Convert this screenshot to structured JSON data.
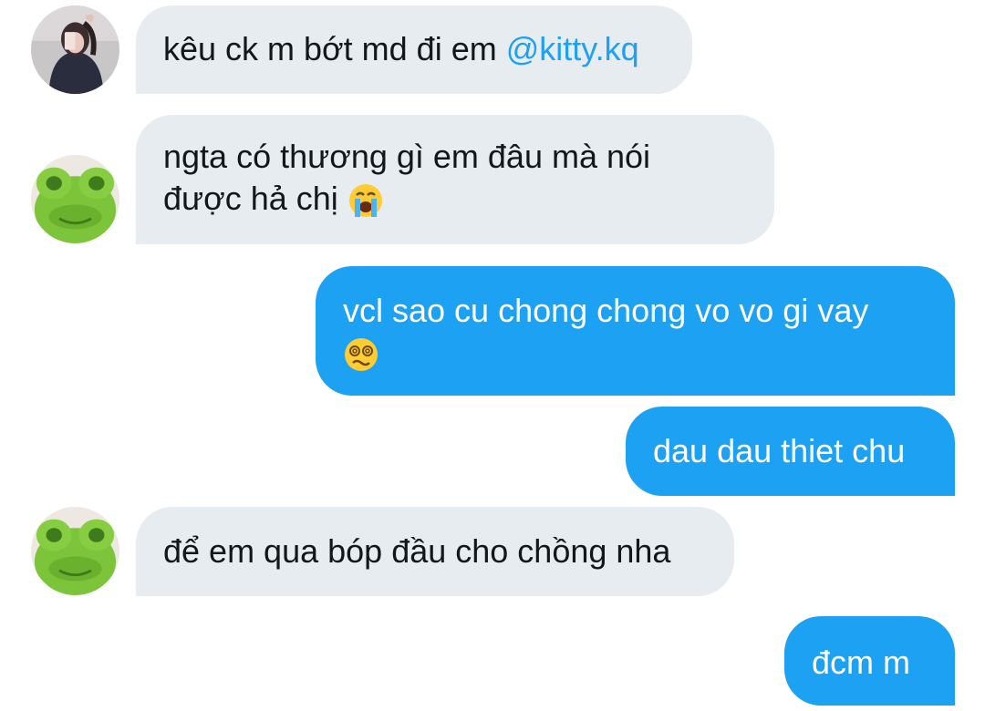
{
  "messages": [
    {
      "text": "kêu ck m bớt md đi em ",
      "mention": "@kitty.kq"
    },
    {
      "line1": "ngta có thương gì em đâu mà nói",
      "line2": "được hả chị ",
      "emoji": "loudly-crying-face-emoji"
    },
    {
      "line1": "vcl sao cu chong chong vo vo gi vay",
      "emoji": "dizzy-face-emoji"
    },
    {
      "text": "dau dau thiet chu"
    },
    {
      "text": "để em qua bóp đầu cho chồng nha"
    },
    {
      "text": "đcm m"
    }
  ],
  "colors": {
    "incoming_bubble": "#e6ecf0",
    "outgoing_bubble": "#1da1f2",
    "mention": "#1da1f2"
  }
}
